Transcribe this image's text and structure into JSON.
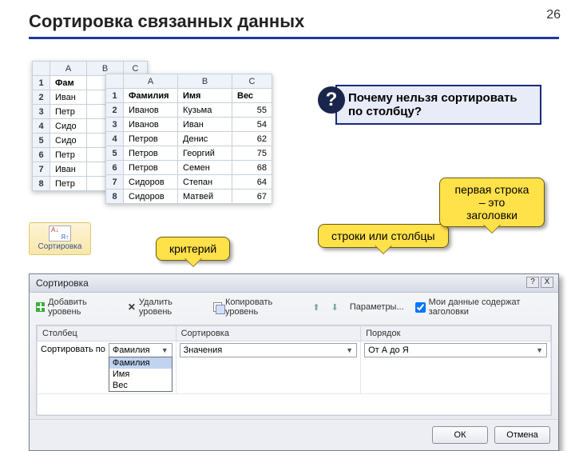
{
  "slide": {
    "title": "Сортировка связанных данных",
    "number": "26"
  },
  "question": {
    "mark": "?",
    "text": "Почему нельзя сортировать по столбцу?"
  },
  "callouts": {
    "criterion": "критерий",
    "rows_cols": "строки или столбцы",
    "first_row": "первая строка – это заголовки"
  },
  "ribbon": {
    "sort_label": "Сортировка"
  },
  "grid_back": {
    "columns": [
      "A",
      "B",
      "C"
    ],
    "rows": [
      {
        "n": "1",
        "a": "Фам"
      },
      {
        "n": "2",
        "a": "Иван"
      },
      {
        "n": "3",
        "a": "Петр"
      },
      {
        "n": "4",
        "a": "Сидо"
      },
      {
        "n": "5",
        "a": "Сидо"
      },
      {
        "n": "6",
        "a": "Петр"
      },
      {
        "n": "7",
        "a": "Иван"
      },
      {
        "n": "8",
        "a": "Петр"
      }
    ]
  },
  "grid_front": {
    "columns": [
      "A",
      "B",
      "C"
    ],
    "header": {
      "a": "Фамилия",
      "b": "Имя",
      "c": "Вес"
    },
    "rows": [
      {
        "n": "2",
        "a": "Иванов",
        "b": "Кузьма",
        "c": "55"
      },
      {
        "n": "3",
        "a": "Иванов",
        "b": "Иван",
        "c": "54"
      },
      {
        "n": "4",
        "a": "Петров",
        "b": "Денис",
        "c": "62"
      },
      {
        "n": "5",
        "a": "Петров",
        "b": "Георгий",
        "c": "75"
      },
      {
        "n": "6",
        "a": "Петров",
        "b": "Семен",
        "c": "68"
      },
      {
        "n": "7",
        "a": "Сидоров",
        "b": "Степан",
        "c": "64"
      },
      {
        "n": "8",
        "a": "Сидоров",
        "b": "Матвей",
        "c": "67"
      }
    ]
  },
  "dialog": {
    "title": "Сортировка",
    "toolbar": {
      "add": "Добавить уровень",
      "del": "Удалить уровень",
      "copy": "Копировать уровень",
      "params": "Параметры...",
      "headers_chk": "Мои данные содержат заголовки"
    },
    "columns": {
      "col1": "Столбец",
      "col2": "Сортировка",
      "col3": "Порядок"
    },
    "row": {
      "label": "Сортировать по",
      "field": "Фамилия",
      "sort_on": "Значения",
      "order": "От А до Я"
    },
    "dropdown": {
      "o1": "Фамилия",
      "o2": "Имя",
      "o3": "Вес"
    },
    "buttons": {
      "ok": "ОК",
      "cancel": "Отмена"
    },
    "win": {
      "help": "?",
      "close": "X"
    }
  }
}
